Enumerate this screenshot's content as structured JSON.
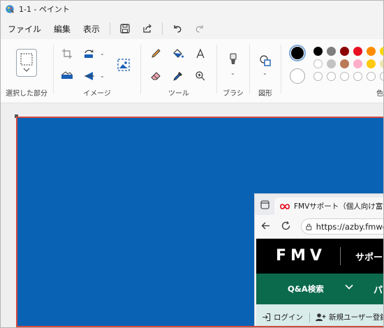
{
  "window": {
    "title": "1-1 - ペイント"
  },
  "menu": {
    "file": "ファイル",
    "edit": "編集",
    "view": "表示"
  },
  "ribbon": {
    "selection_label": "選択した部分",
    "image_label": "イメージ",
    "tools_label": "ツール",
    "brushes_label": "ブラシ",
    "shapes_label": "図形",
    "colors_label": "色"
  },
  "palette": {
    "primary": "#000000",
    "secondary": "#ffffff",
    "row1": [
      "#000000",
      "#7f7f7f",
      "#8b0000",
      "#e81123",
      "#ff8c00",
      "#ffd700"
    ],
    "row2": [
      "#ffffff",
      "#c3c3c3",
      "#b97a57",
      "#ffaec9",
      "#ffc90e",
      "#efe4b0"
    ],
    "row3": [
      "empty",
      "empty",
      "empty",
      "empty",
      "empty",
      "empty"
    ]
  },
  "canvas": {
    "background": "#0a62b5",
    "border": "#d64a3f"
  },
  "browser": {
    "tab_title": "FMVサポート（個人向け富士通",
    "url": "https://azby.fmworld",
    "logo": "FMV",
    "header_text": "サポー",
    "nav_qa": "Q&A検索",
    "nav_more": "パ",
    "login": "ログイン",
    "register": "新規ユーザー登録"
  }
}
